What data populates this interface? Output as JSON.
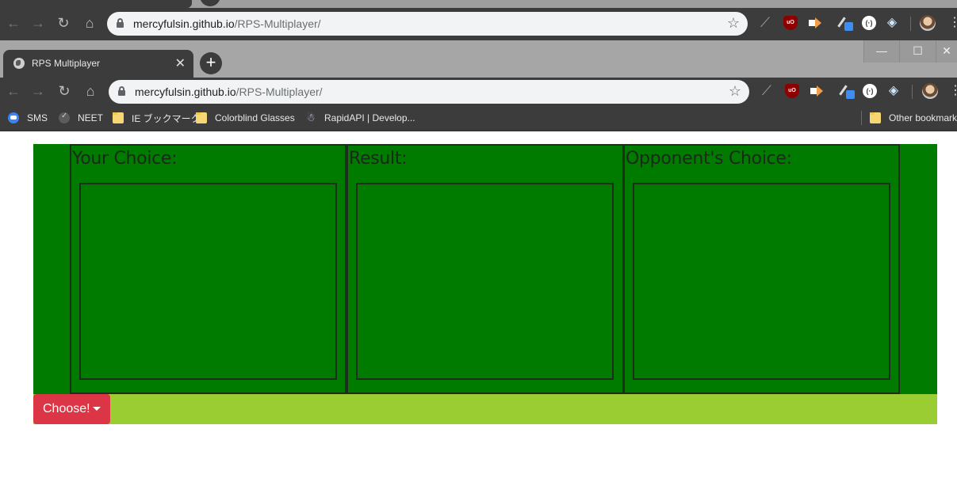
{
  "browser": {
    "tab": {
      "title": "RPS Multiplayer",
      "close_label": "✕"
    },
    "new_tab_label": "+",
    "window_controls": {
      "minimize": "—",
      "maximize": "☐",
      "close": "✕"
    },
    "omnibox": {
      "host": "mercyfulsin.github.io",
      "path": "/RPS-Multiplayer/"
    },
    "nav": {
      "back": "←",
      "forward": "→",
      "reload": "↻",
      "home": "⌂",
      "bookmark_star": "☆"
    },
    "extensions": [
      "feather-icon",
      "ublock-icon",
      "arrow-extension-icon",
      "eyedropper-icon",
      "dark-reader-icon",
      "diamond-icon"
    ],
    "extension_labels": {
      "feather": "⟋",
      "ublock": "uO",
      "circle": "(·)",
      "diamond": "◈"
    },
    "menu_label": "⋮",
    "bookmarks": [
      {
        "label": "SMS",
        "icon": "sms-icon"
      },
      {
        "label": "NEET",
        "icon": "neet-icon"
      },
      {
        "label": "IE ブックマーク",
        "icon": "folder-icon"
      },
      {
        "label": "Colorblind Glasses",
        "icon": "folder-icon"
      },
      {
        "label": "RapidAPI | Develop...",
        "icon": "rapidapi-icon"
      }
    ],
    "other_bookmarks": "Other bookmarks"
  },
  "game": {
    "panels": [
      {
        "title": "Your Choice:"
      },
      {
        "title": "Result:"
      },
      {
        "title": "Opponent's Choice:"
      }
    ],
    "choose_button": "Choose!"
  },
  "colors": {
    "game_background": "#017a00",
    "controls_bar": "#9acd32",
    "choose_button": "#dc3545",
    "chrome_dark": "#3c3c3c"
  }
}
